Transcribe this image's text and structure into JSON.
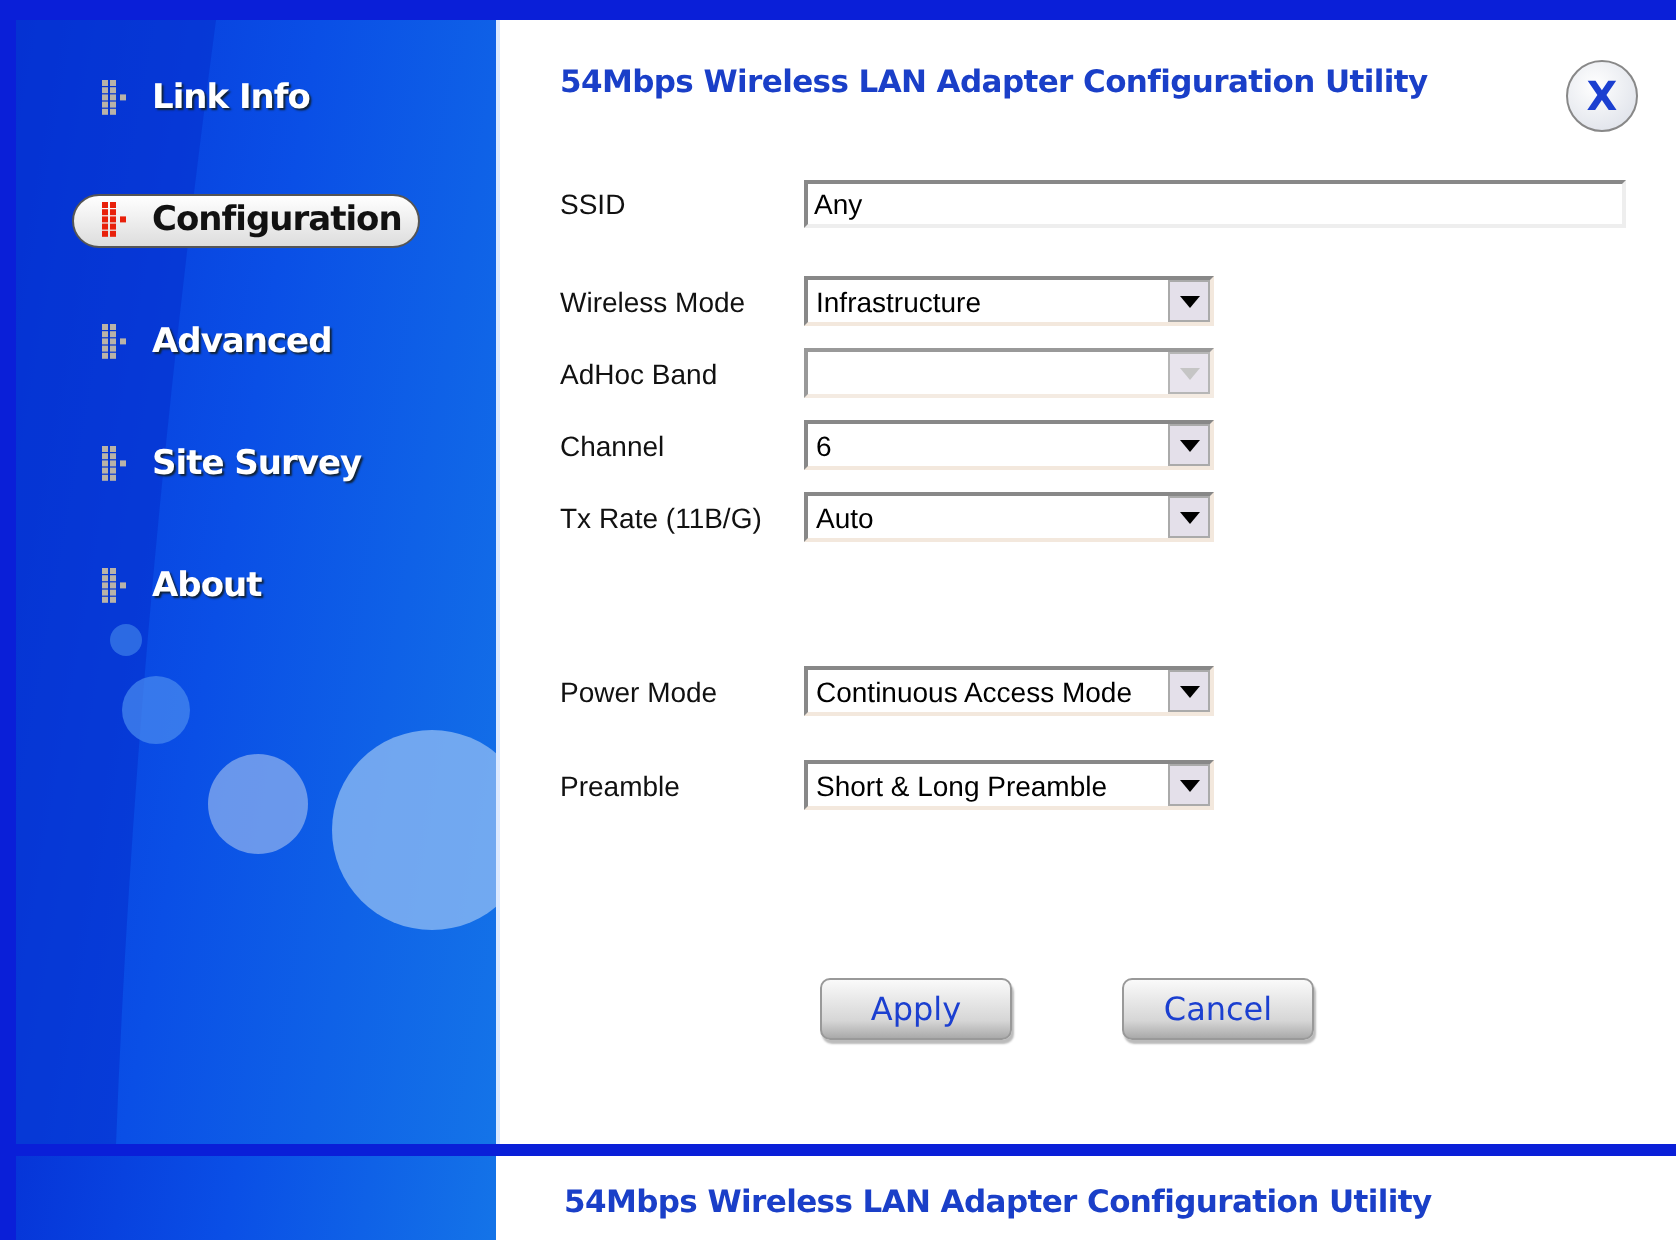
{
  "sidebar": {
    "items": [
      {
        "label": "Link Info",
        "selected": false
      },
      {
        "label": "Configuration",
        "selected": true
      },
      {
        "label": "Advanced",
        "selected": false
      },
      {
        "label": "Site Survey",
        "selected": false
      },
      {
        "label": "About",
        "selected": false
      }
    ]
  },
  "header": {
    "title": "54Mbps Wireless LAN Adapter Configuration Utility",
    "close": "X"
  },
  "ssid": {
    "label": "SSID",
    "value": "Any"
  },
  "radio_settings": [
    {
      "label": "Wireless Mode",
      "value": "Infrastructure",
      "disabled": false
    },
    {
      "label": "AdHoc Band",
      "disabled": true
    },
    {
      "label": "Channel",
      "value": "6",
      "disabled": false
    },
    {
      "label": "Tx Rate (11B/G)",
      "value": "Auto",
      "disabled": false
    }
  ],
  "power_settings": [
    {
      "label": "Power Mode",
      "value": "Continuous Access Mode",
      "disabled": false
    },
    {
      "label": "Preamble",
      "value": "Short & Long Preamble",
      "disabled": false
    }
  ],
  "buttons": [
    "Apply",
    "Cancel"
  ],
  "footer": {
    "title": "54Mbps Wireless LAN Adapter Configuration Utility"
  }
}
